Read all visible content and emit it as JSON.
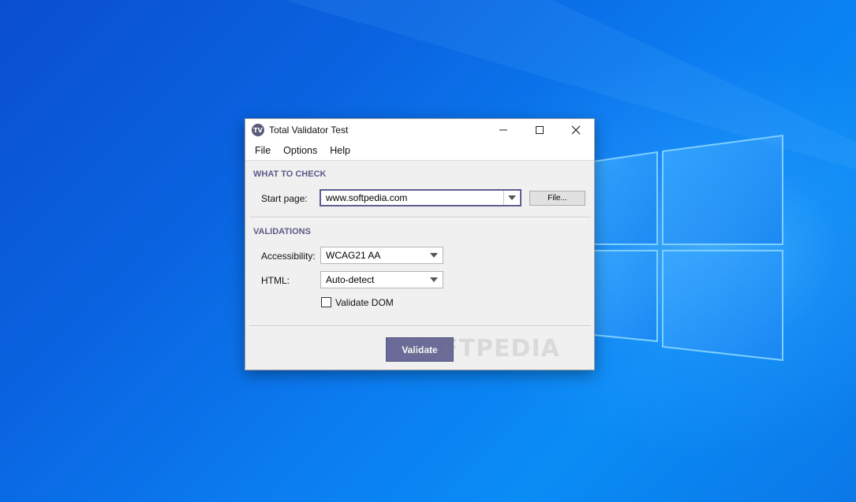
{
  "window": {
    "title": "Total Validator Test",
    "icon_text": "TV",
    "accent_color": "#6b6b9a"
  },
  "menu": {
    "items": [
      "File",
      "Options",
      "Help"
    ]
  },
  "what_to_check": {
    "section_title": "WHAT TO CHECK",
    "start_page_label": "Start page:",
    "start_page_value": "www.softpedia.com",
    "file_button_label": "File..."
  },
  "validations": {
    "section_title": "VALIDATIONS",
    "accessibility_label": "Accessibility:",
    "accessibility_value": "WCAG21 AA",
    "html_label": "HTML:",
    "html_value": "Auto-detect",
    "validate_dom_label": "Validate DOM",
    "validate_dom_checked": false
  },
  "actions": {
    "validate_label": "Validate"
  },
  "watermark": "SOFTPEDIA"
}
